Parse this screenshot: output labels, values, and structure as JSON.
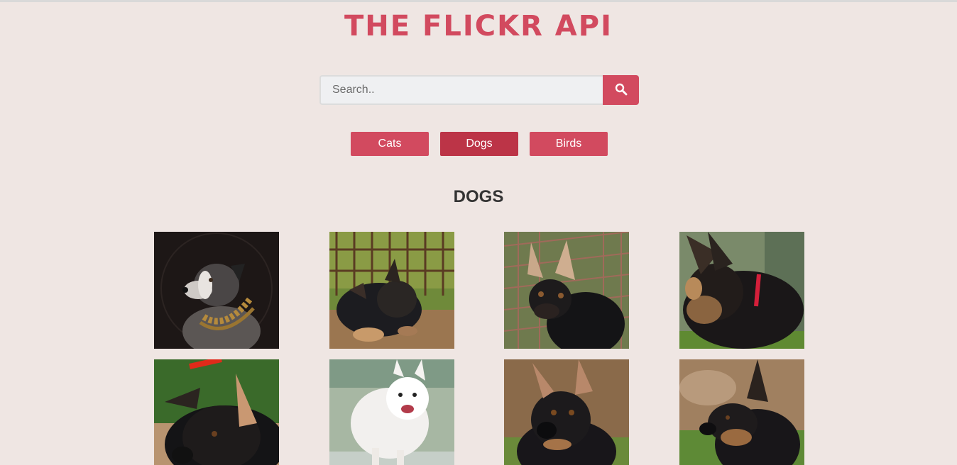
{
  "header": {
    "title": "THE FLICKR API"
  },
  "search": {
    "placeholder": "Search..",
    "value": "",
    "button_icon": "search-icon"
  },
  "categories": [
    {
      "label": "Cats",
      "active": false
    },
    {
      "label": "Dogs",
      "active": true
    },
    {
      "label": "Birds",
      "active": false
    }
  ],
  "results": {
    "title": "DOGS"
  },
  "photos": [
    {
      "subject": "border collie with golden collar"
    },
    {
      "subject": "german shepherd puppy lying by fence"
    },
    {
      "subject": "german shepherd puppy in front of cage"
    },
    {
      "subject": "german shepherd puppy with red collar"
    },
    {
      "subject": "german shepherd puppy close-up"
    },
    {
      "subject": "white spitz dog"
    },
    {
      "subject": "german shepherd puppy portrait"
    },
    {
      "subject": "german shepherd puppy profile"
    }
  ],
  "colors": {
    "accent": "#d24a5f",
    "accent_active": "#bc3447",
    "background": "#efe6e3"
  }
}
